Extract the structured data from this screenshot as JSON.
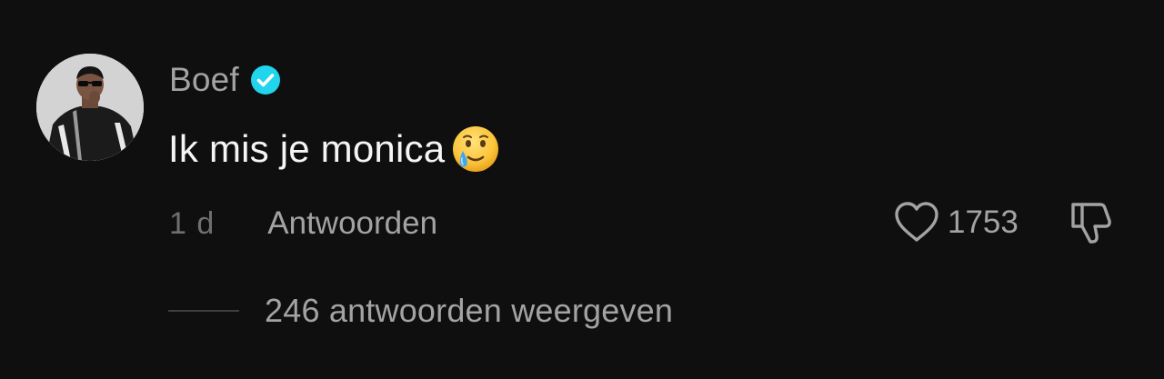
{
  "comment": {
    "username": "Boef",
    "verified": true,
    "text": "Ik mis je monica",
    "emoji": "face-holding-back-tears",
    "time": "1 d",
    "reply_label": "Antwoorden",
    "like_count": "1753",
    "view_replies_label": "246 antwoorden weergeven"
  },
  "colors": {
    "background": "#0f0f0f",
    "username": "#a3a3a3",
    "text": "#f5f5f5",
    "muted": "#6f6f6f",
    "verified_badge": "#20d5ec"
  },
  "icons": {
    "avatar": "avatar",
    "verified": "verified-badge-icon",
    "like": "heart-outline-icon",
    "dislike": "thumbs-down-icon"
  }
}
